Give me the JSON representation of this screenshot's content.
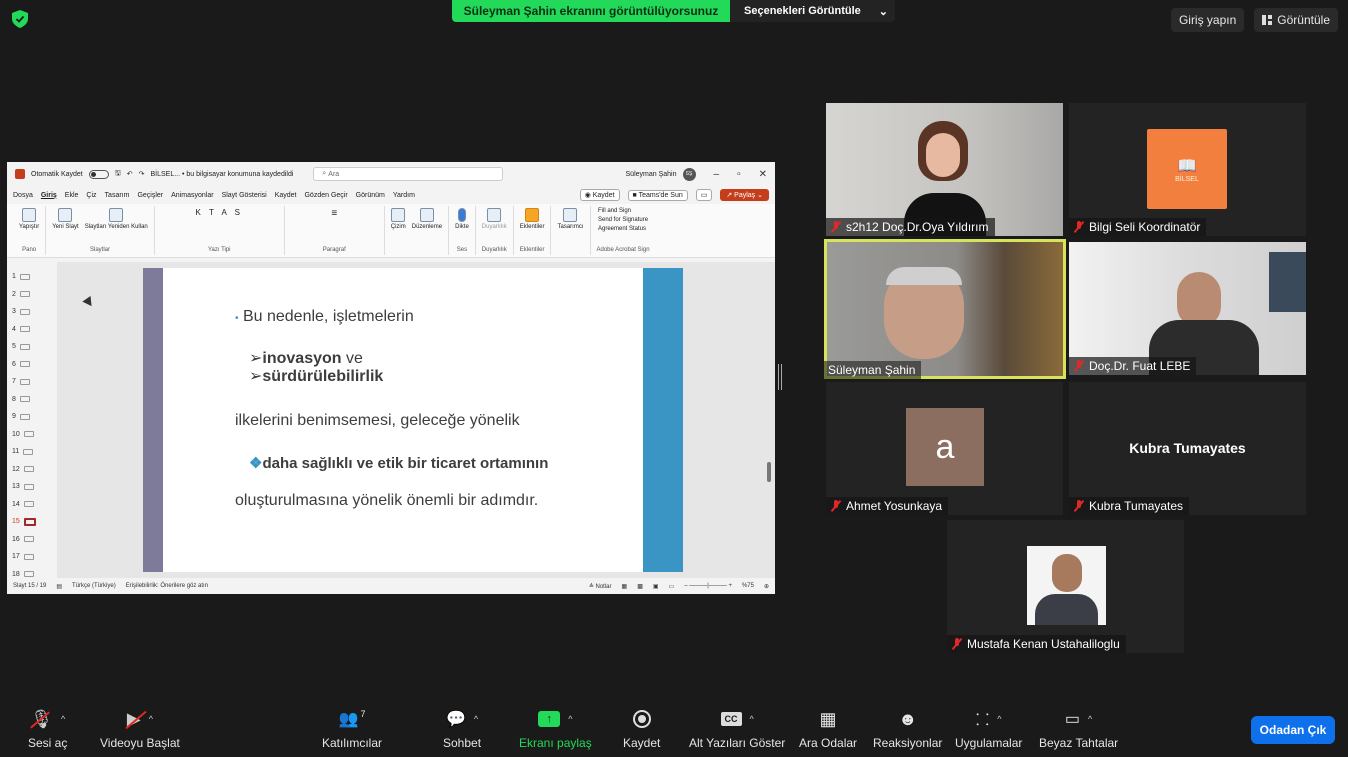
{
  "banner": {
    "sharing_text": "Süleyman Şahin ekranını görüntülüyorsunuz",
    "options_label": "Seçenekleri Görüntüle"
  },
  "top_right": {
    "signin_label": "Giriş yapın",
    "view_label": "Görüntüle"
  },
  "ppt": {
    "autosave_label": "Otomatik Kaydet",
    "doc_title": "BİLSEL... • bu bilgisayar konumuna kaydedildi",
    "search_placeholder": "Ara",
    "user_name": "Süleyman Şahin",
    "user_initials": "SŞ",
    "menu": [
      "Dosya",
      "Giriş",
      "Ekle",
      "Çiz",
      "Tasarım",
      "Geçişler",
      "Animasyonlar",
      "Slayt Gösterisi",
      "Kaydet",
      "Gözden Geçir",
      "Görünüm",
      "Yardım"
    ],
    "record_label": "Kaydet",
    "teams_label": "Teams'de Sun",
    "share_label": "Paylaş",
    "ribbon_groups": [
      {
        "label": "Pano",
        "items": [
          "Yapıştır"
        ]
      },
      {
        "label": "Slaytlar",
        "items": [
          "Yeni Slayt",
          "Slaytları Yeniden Kullan"
        ]
      },
      {
        "label": "Yazı Tipi",
        "items": [
          "K T A S"
        ]
      },
      {
        "label": "Paragraf",
        "items": [
          "≡"
        ]
      },
      {
        "label": "",
        "items": [
          "Çizim",
          "Düzenleme"
        ]
      },
      {
        "label": "Ses",
        "items": [
          "Dikte"
        ]
      },
      {
        "label": "Duyarlılık",
        "items": [
          "Duyarlılık"
        ]
      },
      {
        "label": "Eklentiler",
        "items": [
          "Eklentiler"
        ]
      },
      {
        "label": "",
        "items": [
          "Tasarımcı"
        ]
      }
    ],
    "acrobat": {
      "label": "Adobe Acrobat Sign",
      "items": [
        "Fill and Sign",
        "Send for Signature",
        "Agreement Status"
      ]
    },
    "thumbs": [
      "1",
      "2",
      "3",
      "4",
      "5",
      "6",
      "7",
      "8",
      "9",
      "10",
      "11",
      "12",
      "13",
      "14",
      "15",
      "16",
      "17",
      "18"
    ],
    "selected_thumb": "15",
    "slide": {
      "line1": "Bu nedenle, işletmelerin",
      "bullet1_bold": "inovasyon",
      "bullet1_rest": " ve",
      "bullet2_bold": "sürdürülebilirlik",
      "line2": "ilkelerini benimsemesi, geleceğe yönelik",
      "highlight": "daha sağlıklı ve etik bir ticaret ortamının",
      "line3": "oluşturulmasına yönelik önemli bir adımdır."
    },
    "status": {
      "slide_no": "Slayt 15 / 19",
      "language": "Türkçe (Türkiye)",
      "accessibility": "Erişilebilirlik: Önerilere göz atın",
      "notes": "Notlar",
      "zoom": "%75"
    }
  },
  "participants": [
    {
      "label": "s2h12 Doç.Dr.Oya Yıldırım",
      "muted": true
    },
    {
      "label": "Bilgi Seli Koordinatör",
      "muted": true,
      "logo_text": "BİLSEL"
    },
    {
      "label": "Süleyman Şahin",
      "muted": false,
      "active": true
    },
    {
      "label": "Doç.Dr. Fuat LEBE",
      "muted": true
    },
    {
      "label": "Ahmet Yosunkaya",
      "muted": true,
      "initial": "a"
    },
    {
      "label": "Kubra Tumayates",
      "muted": true,
      "center_name": "Kubra Tumayates"
    },
    {
      "label": "Mustafa Kenan Ustahaliloglu",
      "muted": true
    }
  ],
  "toolbar": {
    "audio": "Sesi aç",
    "video": "Videoyu Başlat",
    "participants": "Katılımcılar",
    "participants_count": "7",
    "chat": "Sohbet",
    "share": "Ekranı paylaş",
    "record": "Kaydet",
    "captions": "Alt Yazıları Göster",
    "captions_icon": "CC",
    "breakout": "Ara Odalar",
    "reactions": "Reaksiyonlar",
    "apps": "Uygulamalar",
    "whiteboards": "Beyaz Tahtalar",
    "leave": "Odadan Çık"
  },
  "colors": {
    "accent_green": "#23d959",
    "leave_blue": "#0e71eb",
    "active_speaker": "#d7e35b",
    "ppt_red": "#c43e1c"
  }
}
